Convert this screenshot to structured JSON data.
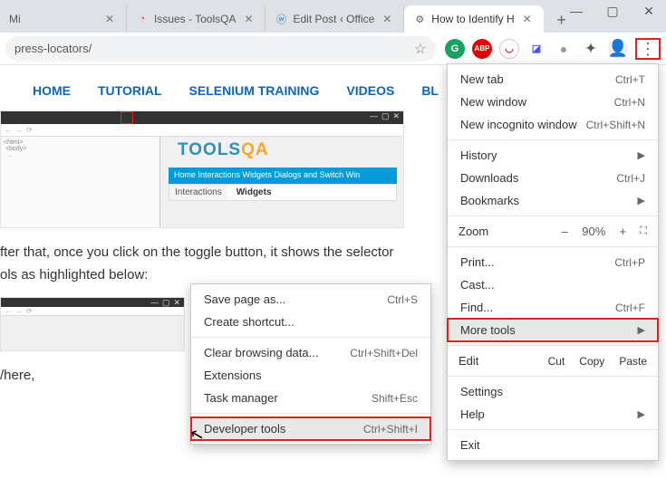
{
  "window": {
    "min": "—",
    "max": "▢",
    "close": "✕"
  },
  "tabs": [
    {
      "title": "Mi",
      "favicon": ""
    },
    {
      "title": "Issues - ToolsQA",
      "favicon": "◔"
    },
    {
      "title": "Edit Post ‹ Office",
      "favicon": "ⓦ"
    },
    {
      "title": "How to Identify H",
      "favicon": "⚙"
    }
  ],
  "newtab": "+",
  "omnibox": {
    "url": "press-locators/",
    "star": "☆"
  },
  "toolbar_icons": {
    "grammarly": "G",
    "abp": "ABP",
    "mcafee": "◡",
    "ublock": "◪",
    "grey_dot": "●",
    "puzzle": "✦",
    "avatar": "👤",
    "kebab": "⋮"
  },
  "site_nav": [
    "HOME",
    "TUTORIAL",
    "SELENIUM TRAINING",
    "VIDEOS",
    "BL"
  ],
  "article": {
    "p1": "fter that, once you click on the toggle button, it shows the selector",
    "p2": "ols as highlighted below:",
    "where": "/here,"
  },
  "placeholder1": {
    "brand": "TOOLS",
    "brand2": "QA",
    "bluebar": "Home   Interactions   Widgets   Dialogs and Switch Win",
    "widgets_lbl": "Interactions",
    "widgets_txt": "Widgets"
  },
  "chrome_menu": {
    "newtab": "New tab",
    "newtab_sc": "Ctrl+T",
    "newwin": "New window",
    "newwin_sc": "Ctrl+N",
    "incog": "New incognito window",
    "incog_sc": "Ctrl+Shift+N",
    "history": "History",
    "downloads": "Downloads",
    "downloads_sc": "Ctrl+J",
    "bookmarks": "Bookmarks",
    "zoom": "Zoom",
    "zoom_minus": "–",
    "zoom_val": "90%",
    "zoom_plus": "+",
    "zoom_full": "⛶",
    "print": "Print...",
    "print_sc": "Ctrl+P",
    "cast": "Cast...",
    "find": "Find...",
    "find_sc": "Ctrl+F",
    "moretools": "More tools",
    "edit": "Edit",
    "cut": "Cut",
    "copy": "Copy",
    "paste": "Paste",
    "settings": "Settings",
    "help": "Help",
    "exit": "Exit"
  },
  "submenu": {
    "savepage": "Save page as...",
    "savepage_sc": "Ctrl+S",
    "shortcut": "Create shortcut...",
    "clear": "Clear browsing data...",
    "clear_sc": "Ctrl+Shift+Del",
    "ext": "Extensions",
    "taskmgr": "Task manager",
    "taskmgr_sc": "Shift+Esc",
    "devtools": "Developer tools",
    "devtools_sc": "Ctrl+Shift+I"
  }
}
